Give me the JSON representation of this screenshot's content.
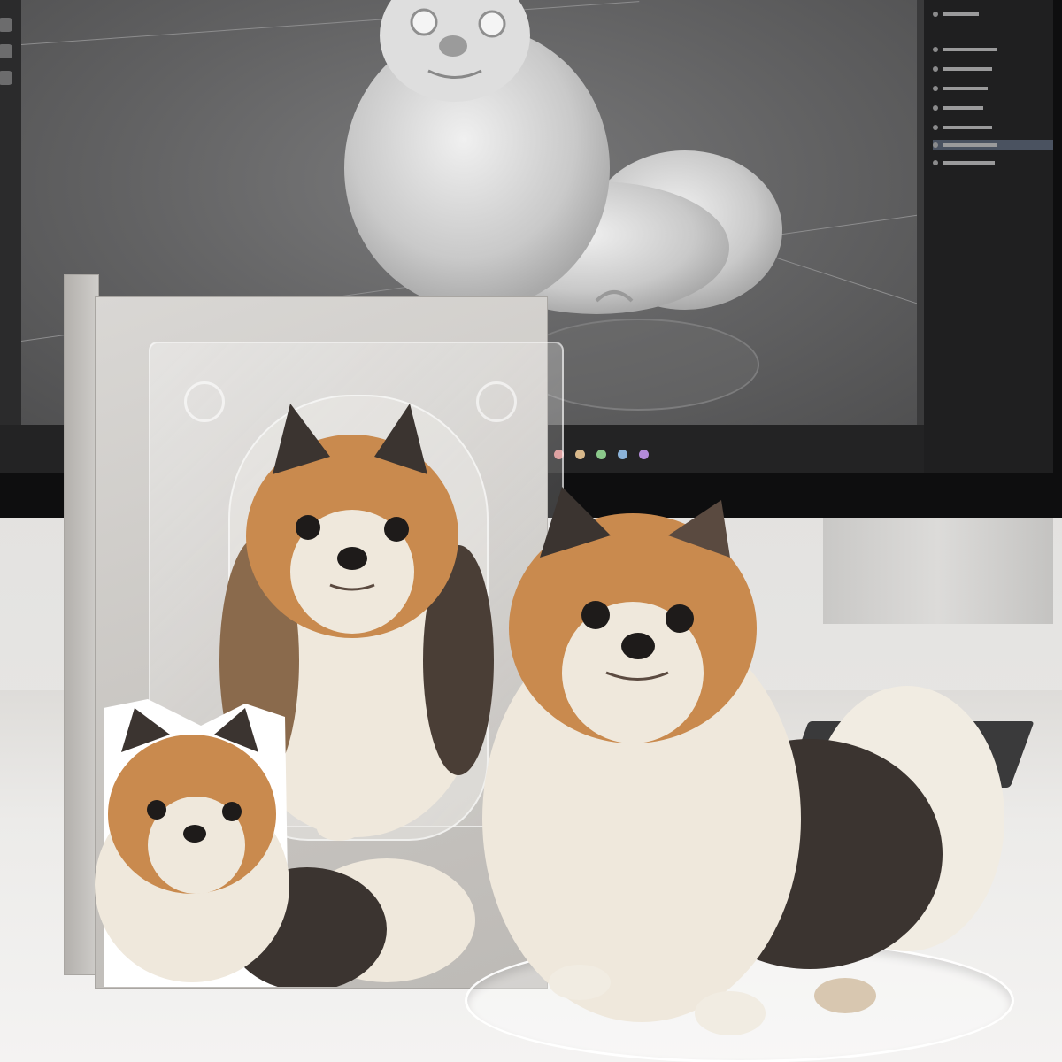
{
  "scene": {
    "description_tags": [
      "desk",
      "monitor",
      "3d-sculpt-viewport",
      "figurine-box",
      "dog-figurine",
      "acrylic-base"
    ],
    "colors": {
      "fur_tan": "#c98a4e",
      "fur_cream": "#efe8dc",
      "fur_dark": "#3b3430",
      "nose": "#1e1b1a",
      "timeline_dots": [
        "#d98b8b",
        "#d9b98b",
        "#8bc98b",
        "#8bb3d9",
        "#b38bd9"
      ]
    }
  }
}
